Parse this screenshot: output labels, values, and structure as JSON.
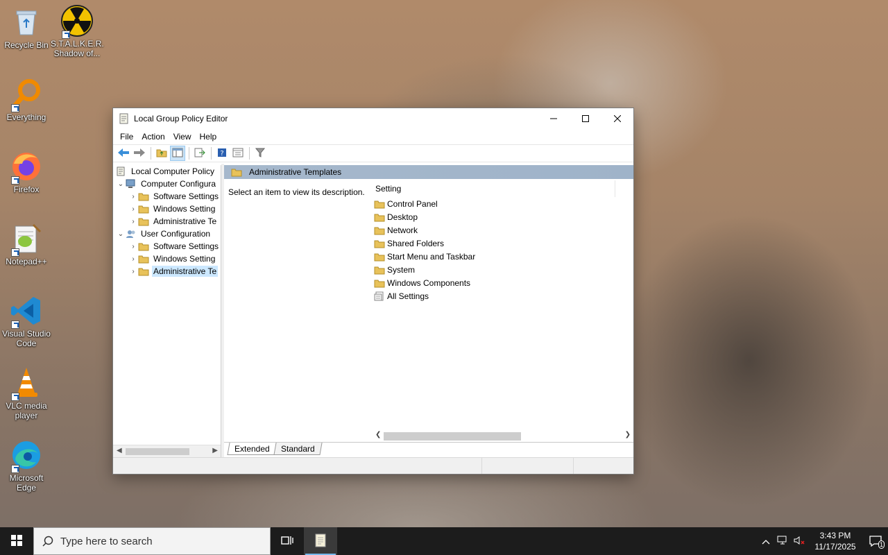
{
  "desktop": {
    "icons": [
      {
        "label": "Recycle Bin",
        "icon": "recycle-bin-icon"
      },
      {
        "label": "S.T.A.L.K.E.R. Shadow of...",
        "icon": "radiation-icon"
      },
      {
        "label": "Everything",
        "icon": "magnifier-icon"
      },
      {
        "label": "Firefox",
        "icon": "firefox-icon"
      },
      {
        "label": "Notepad++",
        "icon": "notepadpp-icon"
      },
      {
        "label": "Visual Studio Code",
        "icon": "vscode-icon"
      },
      {
        "label": "VLC media player",
        "icon": "vlc-cone-icon"
      },
      {
        "label": "Microsoft Edge",
        "icon": "edge-icon"
      }
    ]
  },
  "window": {
    "title": "Local Group Policy Editor",
    "menu": [
      "File",
      "Action",
      "View",
      "Help"
    ],
    "toolbar_icons": [
      "back-arrow-icon",
      "forward-arrow-icon",
      "up-folder-icon",
      "show-hide-tree-icon",
      "export-list-icon",
      "help-icon",
      "properties-icon",
      "filter-icon"
    ],
    "tree": {
      "root": "Local Computer Policy",
      "items": [
        {
          "label": "Computer Configura",
          "level": 1,
          "expanded": true
        },
        {
          "label": "Software Settings",
          "level": 2
        },
        {
          "label": "Windows Setting",
          "level": 2
        },
        {
          "label": "Administrative Te",
          "level": 2
        },
        {
          "label": "User Configuration",
          "level": 1,
          "expanded": true
        },
        {
          "label": "Software Settings",
          "level": 2
        },
        {
          "label": "Windows Setting",
          "level": 2
        },
        {
          "label": "Administrative Te",
          "level": 2,
          "selected": true
        }
      ]
    },
    "right": {
      "header": "Administrative Templates",
      "description": "Select an item to view its description.",
      "column_header": "Setting",
      "items": [
        {
          "label": "Control Panel",
          "icon": "folder-icon"
        },
        {
          "label": "Desktop",
          "icon": "folder-icon"
        },
        {
          "label": "Network",
          "icon": "folder-icon"
        },
        {
          "label": "Shared Folders",
          "icon": "folder-icon"
        },
        {
          "label": "Start Menu and Taskbar",
          "icon": "folder-icon"
        },
        {
          "label": "System",
          "icon": "folder-icon"
        },
        {
          "label": "Windows Components",
          "icon": "folder-icon"
        },
        {
          "label": "All Settings",
          "icon": "all-settings-icon"
        }
      ]
    },
    "tabs": [
      "Extended",
      "Standard"
    ]
  },
  "taskbar": {
    "search_placeholder": "Type here to search",
    "time": "3:43 PM",
    "date": "11/17/2025",
    "notification_count": "1"
  },
  "colors": {
    "selection": "#cce8ff",
    "header_bar": "#a6b8cc",
    "taskbar": "#1c1c1c",
    "folder": "#e8c25a"
  }
}
